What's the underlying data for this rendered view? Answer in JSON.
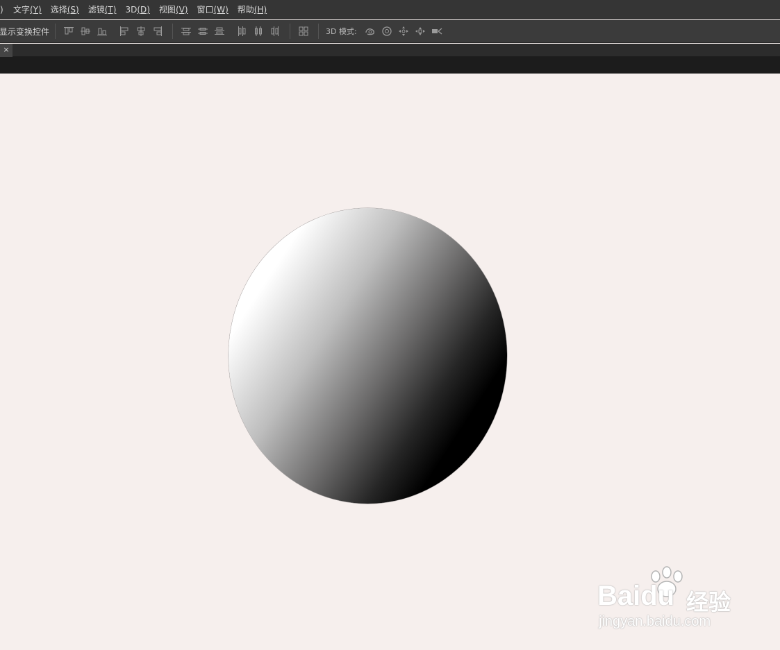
{
  "menubar": {
    "lead": ")",
    "items": [
      {
        "label": "文字",
        "key": "(Y)"
      },
      {
        "label": "选择",
        "key": "(S)"
      },
      {
        "label": "滤镜",
        "key": "(T)"
      },
      {
        "label": "3D",
        "key": "(D)"
      },
      {
        "label": "视图",
        "key": "(V)"
      },
      {
        "label": "窗口",
        "key": "(W)"
      },
      {
        "label": "帮助",
        "key": "(H)"
      }
    ]
  },
  "options": {
    "transform_label": "显示变换控件",
    "mode_label": "3D 模式:",
    "icons": {
      "align": [
        "align-top-icon",
        "align-vcenter-icon",
        "align-bottom-icon",
        "align-left-icon",
        "align-hcenter-icon",
        "align-right-icon"
      ],
      "distribute": [
        "distribute-top-icon",
        "distribute-vcenter-icon",
        "distribute-bottom-icon",
        "distribute-left-icon",
        "distribute-hcenter-icon",
        "distribute-right-icon"
      ],
      "auto_align": "auto-align-icon",
      "mode_3d": [
        "rotate-3d-icon",
        "roll-3d-icon",
        "drag-3d-icon",
        "slide-3d-icon",
        "scale-3d-icon"
      ]
    }
  },
  "document_tab": {
    "close": "×"
  },
  "watermark": {
    "logo": "Bai",
    "logo_tail": "du",
    "cn": "经验",
    "url": "jingyan.baidu.com"
  },
  "colors": {
    "menubar_bg": "#353535",
    "optionsbar_bg": "#3b3b3b",
    "canvas_bg": "#f6efed"
  }
}
